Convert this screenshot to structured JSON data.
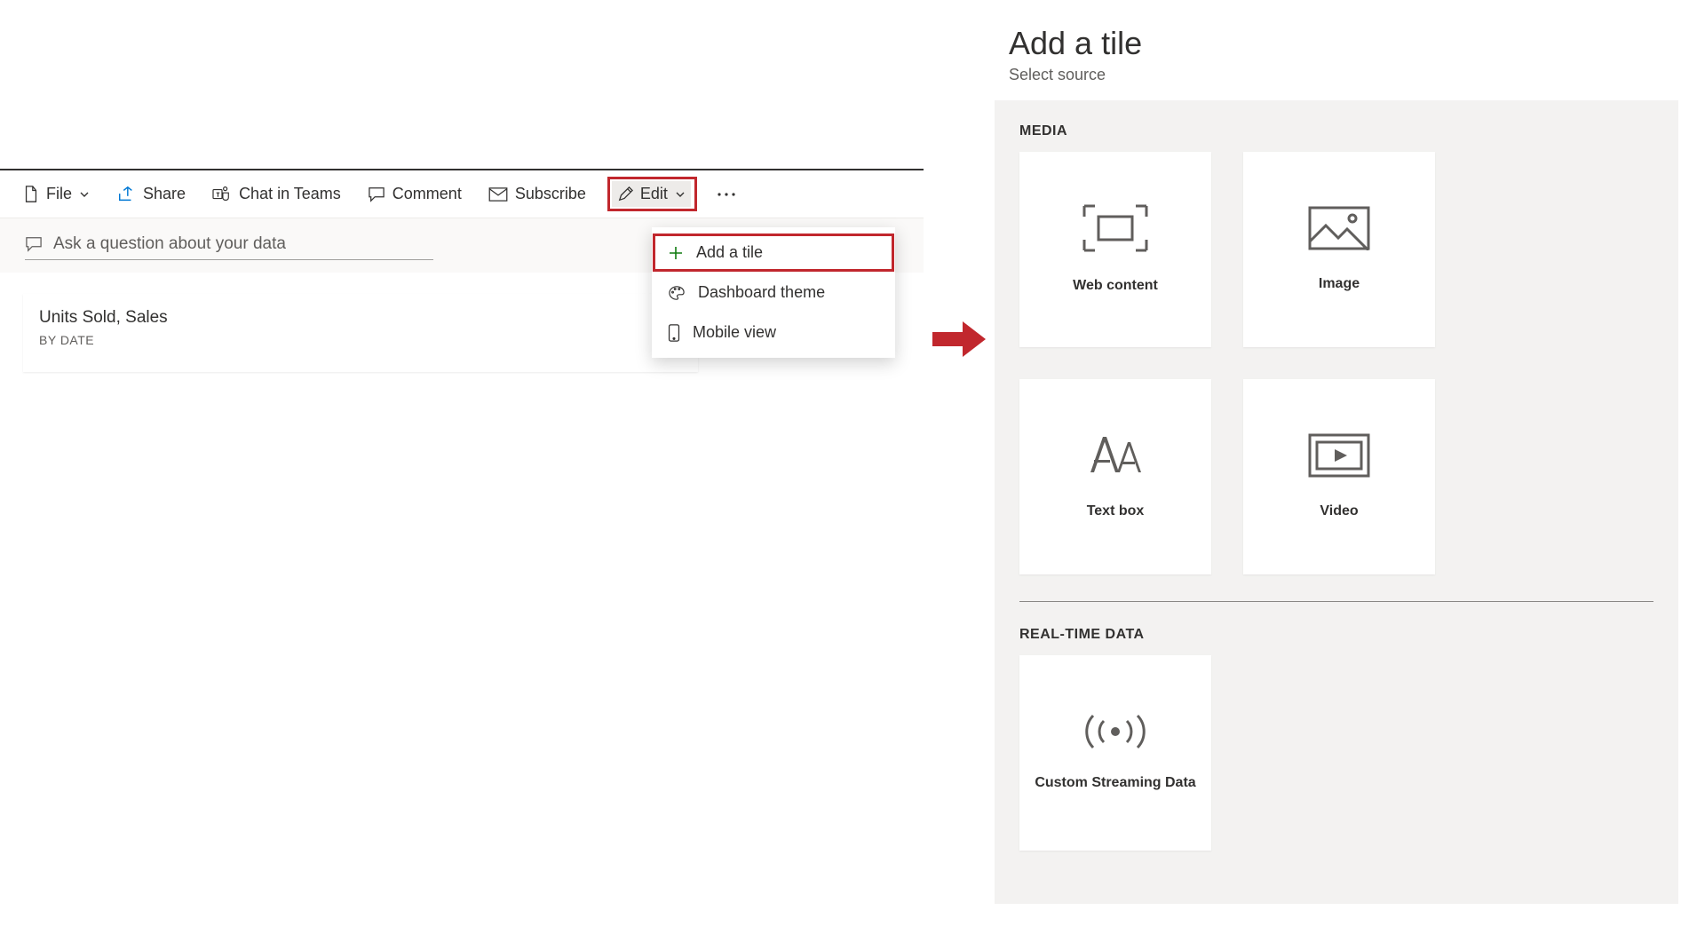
{
  "toolbar": {
    "file": "File",
    "share": "Share",
    "chat": "Chat in Teams",
    "comment": "Comment",
    "subscribe": "Subscribe",
    "edit": "Edit"
  },
  "dropdown": {
    "add_tile": "Add a tile",
    "dashboard_theme": "Dashboard theme",
    "mobile_view": "Mobile view"
  },
  "qna": {
    "placeholder": "Ask a question about your data"
  },
  "tile": {
    "title": "Units Sold, Sales",
    "subtitle": "BY DATE"
  },
  "panel": {
    "title": "Add a tile",
    "subtitle": "Select source",
    "section_media": "MEDIA",
    "section_realtime": "REAL-TIME DATA",
    "options": {
      "web_content": "Web content",
      "image": "Image",
      "text_box": "Text box",
      "video": "Video",
      "streaming": "Custom Streaming Data"
    }
  }
}
